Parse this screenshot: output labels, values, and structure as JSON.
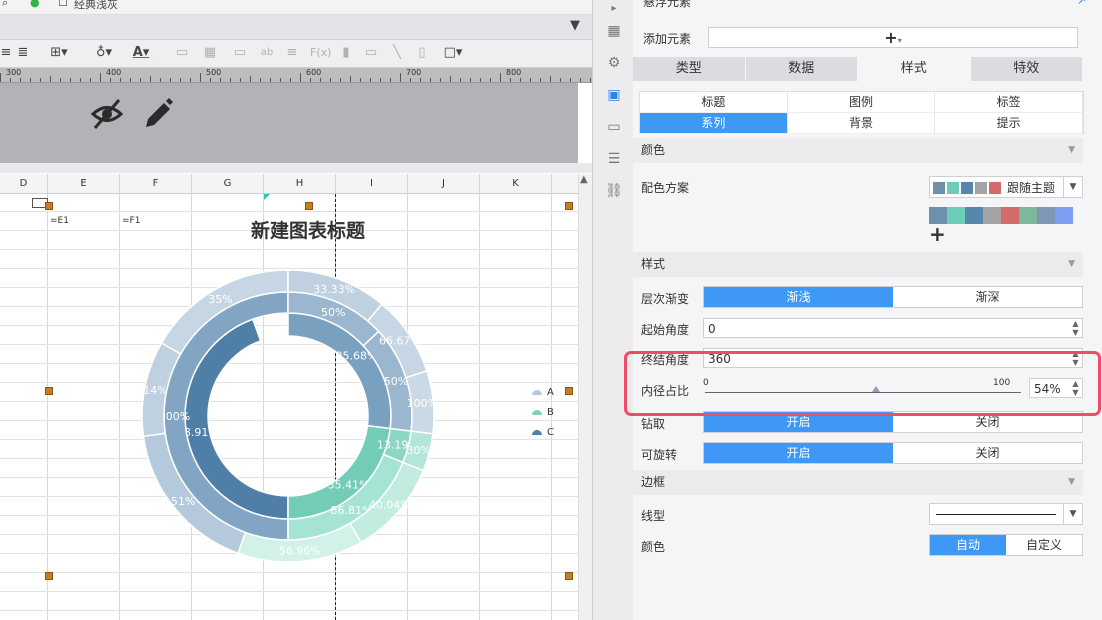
{
  "top": {
    "label": "经典浅灰"
  },
  "ruler": {
    "labels": [
      "300",
      "400",
      "500",
      "600",
      "700",
      "800"
    ]
  },
  "columns": [
    "D",
    "E",
    "F",
    "G",
    "H",
    "I",
    "J",
    "K"
  ],
  "cells": {
    "e1": "=E1",
    "f1": "=F1"
  },
  "chart_data": {
    "type": "pie",
    "title": "新建图表标题",
    "variant": "multi-level donut",
    "rings": [
      {
        "level": "inner",
        "slices": [
          {
            "name": "C",
            "label": "38.91%",
            "value": 38.91
          },
          {
            "name": "C",
            "label": "25.68%",
            "value": 25.68
          },
          {
            "name": "B",
            "label": "35.41%",
            "value": 35.41
          }
        ]
      },
      {
        "level": "middle",
        "slices": [
          {
            "label": "100%",
            "value": 100
          },
          {
            "label": "50%",
            "value": 50
          },
          {
            "label": "50%",
            "value": 50
          },
          {
            "label": "13.19%",
            "value": 13.19
          },
          {
            "label": "86.81%",
            "value": 86.81
          }
        ]
      },
      {
        "level": "outer",
        "slices": [
          {
            "label": "51%",
            "value": 51
          },
          {
            "label": "14%",
            "value": 14
          },
          {
            "label": "35%",
            "value": 35
          },
          {
            "label": "33.33%",
            "value": 33.33
          },
          {
            "label": "66.67%",
            "value": 66.67
          },
          {
            "label": "100%",
            "value": 100
          },
          {
            "label": "30%",
            "value": 30
          },
          {
            "label": "40.04%",
            "value": 40.04
          },
          {
            "label": "56.96%",
            "value": 56.96
          }
        ]
      }
    ],
    "legend": {
      "position": "right",
      "entries": [
        "A",
        "B",
        "C"
      ]
    },
    "colors": {
      "A": "#b5c9dc",
      "B": "#7ad0bb",
      "C": "#4f7ea6"
    }
  },
  "panel": {
    "header": "悬浮元素",
    "add_element": "添加元素",
    "add_symbol": "+",
    "tabs": [
      "类型",
      "数据",
      "样式",
      "特效"
    ],
    "active_tab": "样式",
    "subtabs": [
      "标题",
      "图例",
      "标签",
      "系列",
      "背景",
      "提示"
    ],
    "active_subtab": "系列",
    "color_section": "颜色",
    "scheme_label": "配色方案",
    "scheme_value": "跟随主题",
    "scheme_colors": [
      "#6f90ad",
      "#6ccdb9",
      "#5487a9",
      "#a4a4a4",
      "#d46b6b"
    ],
    "palette": [
      "#6f90ad",
      "#6ccdb9",
      "#5487a9",
      "#a4a4a4",
      "#d46b6b",
      "#7db89a",
      "#7d97b5",
      "#7b9ef0"
    ],
    "palette_add": "+",
    "style_section": "样式",
    "gradient_label": "层次渐变",
    "gradient_options": [
      "渐浅",
      "渐深"
    ],
    "start_angle_label": "起始角度",
    "start_angle_value": "0",
    "end_angle_label": "终结角度",
    "end_angle_value": "360",
    "inner_radius_label": "内径占比",
    "slider_min": "0",
    "slider_max": "100",
    "inner_radius_value": "54%",
    "inner_radius_fraction": 0.54,
    "pick_label": "钻取",
    "pick_options": [
      "开启",
      "关闭"
    ],
    "rotate_label": "可旋转",
    "rotate_options": [
      "开启",
      "关闭"
    ],
    "border_section": "边框",
    "line_label": "线型",
    "border_color_label": "颜色",
    "border_color_options": [
      "自动",
      "自定义"
    ],
    "highlight_color": "#ef4d67",
    "accent": "#3f97f6"
  }
}
